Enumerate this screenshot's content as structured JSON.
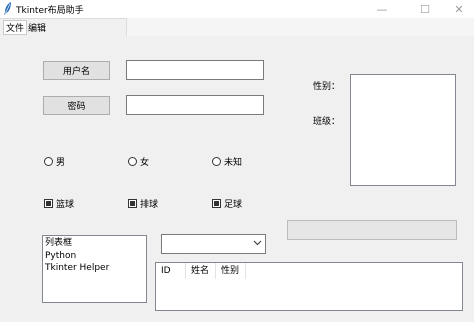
{
  "window": {
    "title": "Tkinter布局助手"
  },
  "controls": {
    "minimize": "—",
    "maximize": "☐",
    "close": "✕"
  },
  "menu": {
    "file": "文件",
    "edit": "编辑"
  },
  "form": {
    "username_button": "用户名",
    "password_button": "密码",
    "username_value": "",
    "password_value": ""
  },
  "side": {
    "gender_label": "性别：",
    "class_label": "班级："
  },
  "radios": [
    "男",
    "女",
    "未知"
  ],
  "checks": [
    "篮球",
    "排球",
    "足球"
  ],
  "listbox": {
    "items": [
      "列表框",
      "Python",
      "Tkinter Helper"
    ]
  },
  "combobox": {
    "value": ""
  },
  "table": {
    "columns": [
      "ID",
      "姓名",
      "性别"
    ]
  },
  "progress": {
    "value": 0
  }
}
